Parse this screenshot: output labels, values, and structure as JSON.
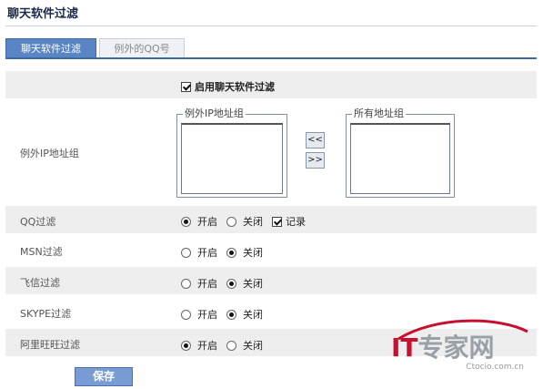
{
  "page": {
    "title": "聊天软件过滤"
  },
  "tabs": [
    {
      "label": "聊天软件过滤",
      "active": true
    },
    {
      "label": "例外的QQ号",
      "active": false
    }
  ],
  "enable": {
    "label": "启用聊天软件过滤",
    "checked": true
  },
  "exception_group": {
    "row_label": "例外IP地址组",
    "left_box_title": "例外IP地址组",
    "right_box_title": "所有地址组",
    "btn_left": "<<",
    "btn_right": ">>"
  },
  "options": {
    "on": "开启",
    "off": "关闭",
    "log": "记录"
  },
  "filters": [
    {
      "name": "QQ过滤",
      "value": "on",
      "log": true
    },
    {
      "name": "MSN过滤",
      "value": "off"
    },
    {
      "name": "飞信过滤",
      "value": "off"
    },
    {
      "name": "SKYPE过滤",
      "value": "off"
    },
    {
      "name": "阿里旺旺过滤",
      "value": "on"
    }
  ],
  "save_label": "保存",
  "watermark": {
    "brand_prefix": "IT",
    "brand_suffix": "专家网",
    "url": "Ctocio.com.cn"
  }
}
